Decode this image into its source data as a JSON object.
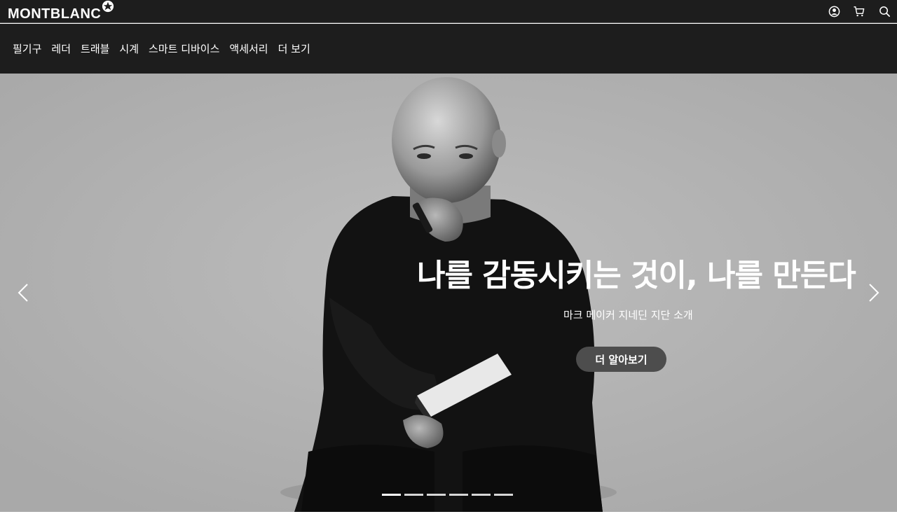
{
  "brand": {
    "name": "MONTBLANC",
    "star_icon": "montblanc-star-icon"
  },
  "top_icons": [
    {
      "name": "account-icon"
    },
    {
      "name": "cart-icon"
    },
    {
      "name": "search-icon"
    }
  ],
  "nav": {
    "items": [
      {
        "label": "필기구"
      },
      {
        "label": "레더"
      },
      {
        "label": "트래블"
      },
      {
        "label": "시계"
      },
      {
        "label": "스마트 디바이스"
      },
      {
        "label": "액세서리"
      },
      {
        "label": "더 보기"
      }
    ]
  },
  "hero": {
    "title": "나를 감동시키는 것이, 나를 만든다",
    "subtitle": "마크 메이커 지네딘 지단 소개",
    "cta_label": "더 알아보기",
    "prev_icon": "chevron-left-icon",
    "next_icon": "chevron-right-icon",
    "slide_count": 6,
    "active_slide": 1
  },
  "colors": {
    "header_bg": "#1d1d1d",
    "hero_bg": "#b1b1b1",
    "cta_bg": "#4d4d4d"
  }
}
